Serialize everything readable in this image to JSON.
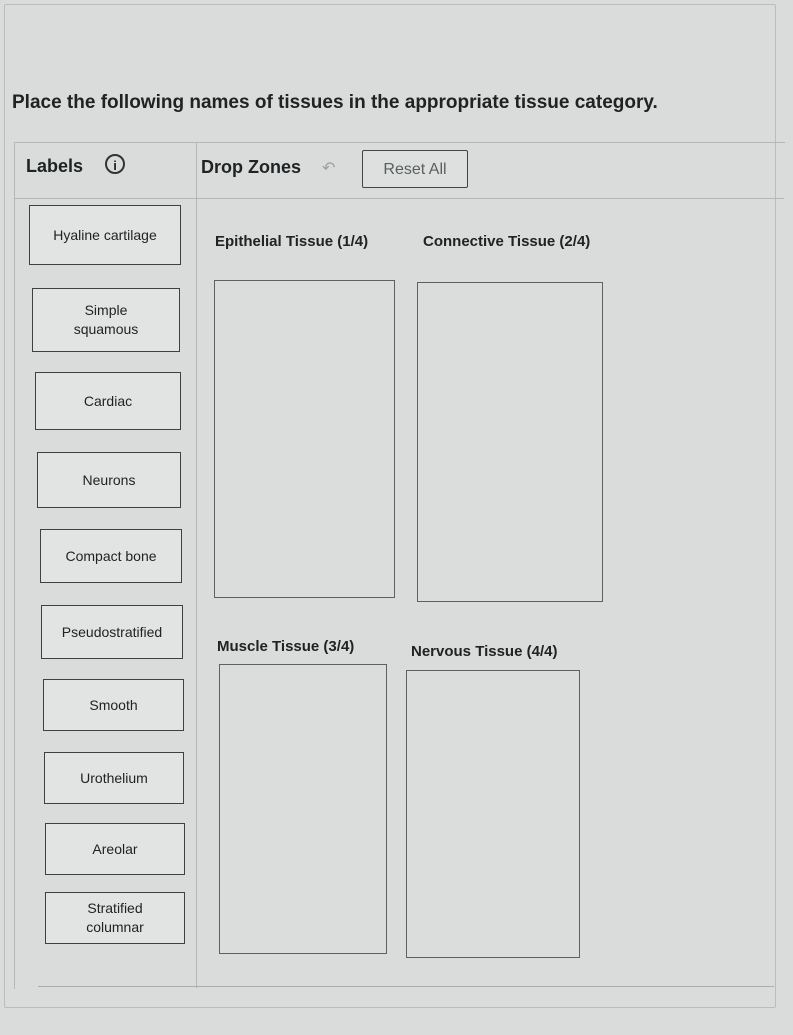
{
  "question": "Place the following names of tissues in the appropriate tissue category.",
  "labels_panel": {
    "title": "Labels",
    "info_icon": "i"
  },
  "drop_panel": {
    "title": "Drop Zones",
    "undo_icon": "↶",
    "reset_label": "Reset All"
  },
  "labels": [
    "Hyaline cartilage",
    "Simple squamous",
    "Cardiac",
    "Neurons",
    "Compact bone",
    "Pseudostratified",
    "Smooth",
    "Urothelium",
    "Areolar",
    "Stratified columnar"
  ],
  "zones": [
    {
      "title": "Epithelial Tissue (1/4)"
    },
    {
      "title": "Connective Tissue (2/4)"
    },
    {
      "title": "Muscle Tissue (3/4)"
    },
    {
      "title": "Nervous Tissue (4/4)"
    }
  ]
}
